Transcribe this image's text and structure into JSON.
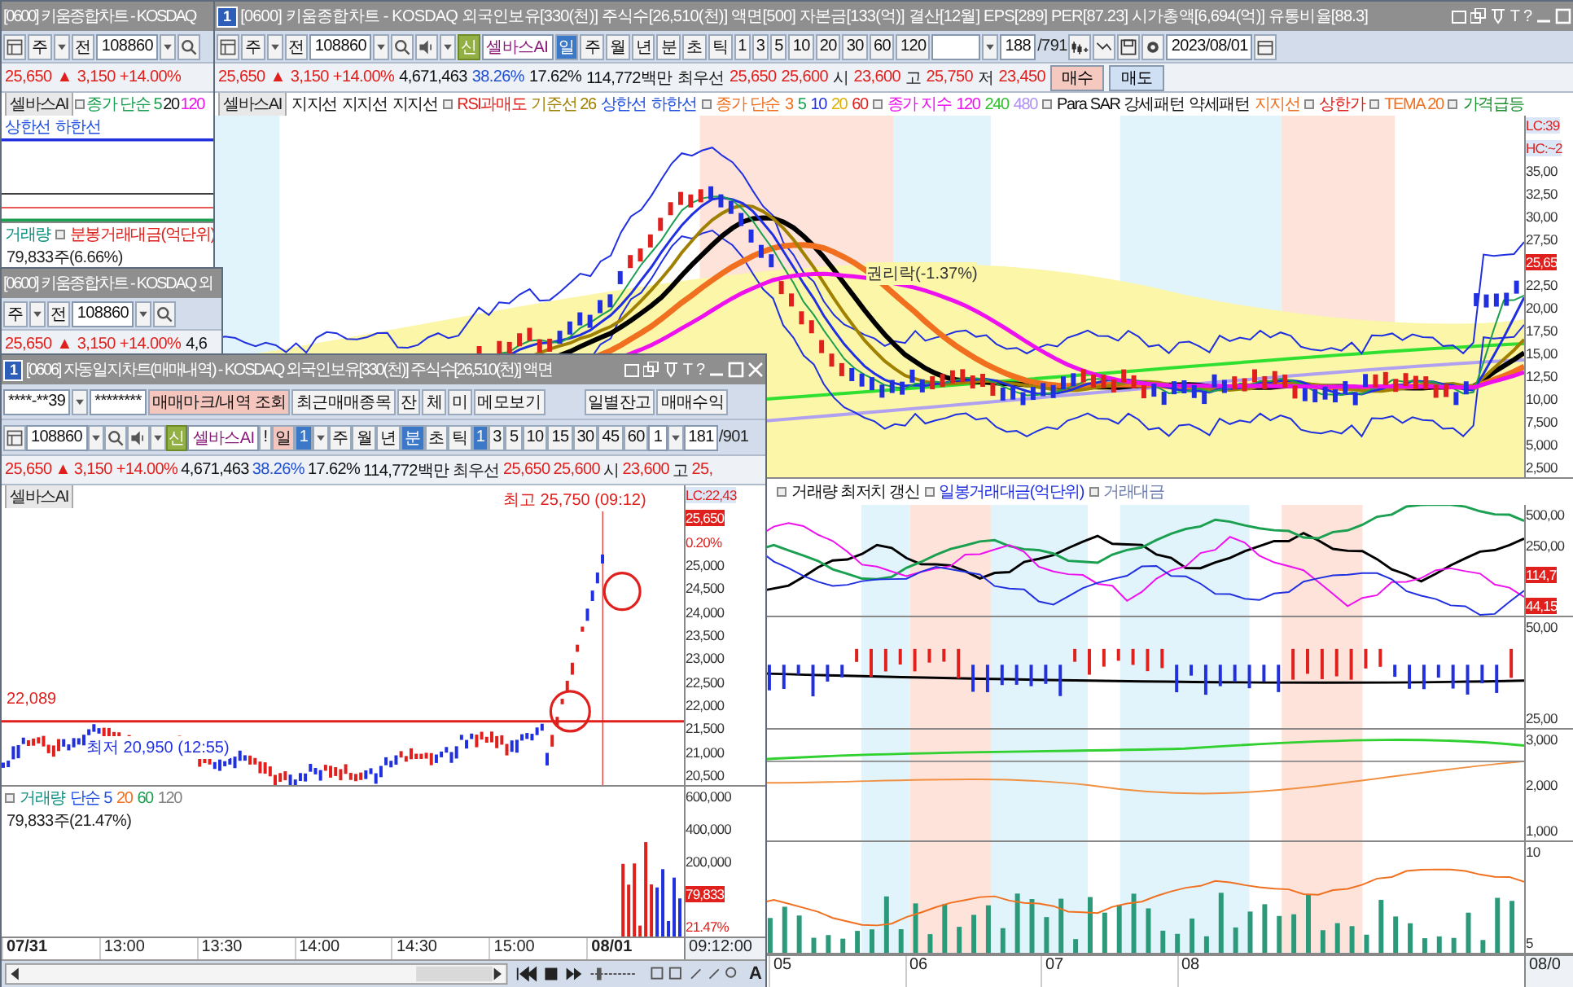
{
  "back_window_top": {
    "title": "[0600] 키움종합차트 - KOSDAQ",
    "toolbar": [
      {
        "kind": "layout"
      },
      {
        "kind": "button",
        "label": "주"
      },
      {
        "kind": "dropdown"
      },
      {
        "kind": "button",
        "label": "전"
      },
      {
        "kind": "field",
        "value": "108860"
      },
      {
        "kind": "dropdown"
      },
      {
        "kind": "search"
      }
    ],
    "info": [
      {
        "kind": "value",
        "text": "25,650",
        "color": "#e0201c"
      },
      {
        "kind": "value",
        "text": "▲",
        "color": "#e0201c"
      },
      {
        "kind": "value",
        "text": "3,150 +14.00%",
        "color": "#e0201c"
      }
    ],
    "legend": [
      {
        "kind": "label",
        "text": "셀바스AI"
      },
      {
        "kind": "marker"
      },
      {
        "kind": "text",
        "text": "종가 단순 5",
        "color": "#1aa050"
      },
      {
        "kind": "text",
        "text": "20",
        "color": "#111111"
      },
      {
        "kind": "text",
        "text": "120",
        "color": "#ee10ee"
      }
    ],
    "legend_2": [
      {
        "kind": "text",
        "text": "상한선",
        "color": "#2050e0"
      },
      {
        "kind": "text",
        "text": "하한선",
        "color": "#2050e0"
      }
    ],
    "volume_legend": [
      {
        "kind": "text",
        "text": "거래량",
        "color": "#109080"
      },
      {
        "kind": "marker"
      },
      {
        "kind": "text",
        "text": "분봉거래대금(억단위)",
        "color": "#e0201c"
      }
    ],
    "volume_reading": "79,833주(6.66%)"
  },
  "back_window_bottom": {
    "title": "[0600] 키움종합차트 - KOSDAQ 외",
    "toolbar": [
      {
        "kind": "button",
        "label": "주"
      },
      {
        "kind": "dropdown"
      },
      {
        "kind": "button",
        "label": "전"
      },
      {
        "kind": "field",
        "value": "108860"
      },
      {
        "kind": "dropdown"
      },
      {
        "kind": "search"
      }
    ],
    "info": [
      {
        "kind": "value",
        "text": "25,650",
        "color": "#e0201c"
      },
      {
        "kind": "value",
        "text": "▲",
        "color": "#e0201c"
      },
      {
        "kind": "value",
        "text": "3,150 +14.00%",
        "color": "#e0201c"
      },
      {
        "kind": "value",
        "text": "4,6",
        "color": "#111111"
      }
    ]
  },
  "main_window": {
    "badge": "1",
    "title": "[0600] 키움종합차트 - KOSDAQ 외국인보유[330(천)] 주식수[26,510(천)] 액면[500] 자본금[133(억)] 결산[12월] EPS[289] PER[87.23] 시가총액[6,694(억)] 유통비율[88.3]",
    "controls": [
      {
        "kind": "restore"
      },
      {
        "kind": "tile"
      },
      {
        "kind": "pin"
      },
      {
        "kind": "text",
        "label": "T"
      },
      {
        "kind": "text",
        "label": "?"
      },
      {
        "kind": "minimize"
      },
      {
        "kind": "maximize"
      }
    ],
    "toolbar": [
      {
        "kind": "layout"
      },
      {
        "kind": "button",
        "label": "주"
      },
      {
        "kind": "dropdown"
      },
      {
        "kind": "button",
        "label": "전"
      },
      {
        "kind": "field",
        "value": "108860"
      },
      {
        "kind": "dropdown"
      },
      {
        "kind": "search"
      },
      {
        "kind": "speaker"
      },
      {
        "kind": "dropdown"
      },
      {
        "kind": "tag",
        "label": "신"
      },
      {
        "kind": "name-field",
        "value": "셀바스AI"
      },
      {
        "kind": "toggle",
        "label": "일",
        "selected": true
      },
      {
        "kind": "toggle",
        "label": "주",
        "selected": false
      },
      {
        "kind": "toggle",
        "label": "월",
        "selected": false
      },
      {
        "kind": "toggle",
        "label": "년",
        "selected": false
      },
      {
        "kind": "toggle",
        "label": "분",
        "selected": false
      },
      {
        "kind": "toggle",
        "label": "초",
        "selected": false
      },
      {
        "kind": "toggle",
        "label": "틱",
        "selected": false
      },
      {
        "kind": "toggle",
        "label": "1",
        "selected": false
      },
      {
        "kind": "toggle",
        "label": "3",
        "selected": false
      },
      {
        "kind": "toggle",
        "label": "5",
        "selected": false
      },
      {
        "kind": "toggle",
        "label": "10",
        "selected": false
      },
      {
        "kind": "toggle",
        "label": "20",
        "selected": false
      },
      {
        "kind": "toggle",
        "label": "30",
        "selected": false
      },
      {
        "kind": "toggle",
        "label": "60",
        "selected": false
      },
      {
        "kind": "toggle",
        "label": "120",
        "selected": false
      },
      {
        "kind": "blank-field"
      },
      {
        "kind": "dropdown"
      },
      {
        "kind": "field",
        "value": "188"
      },
      {
        "kind": "text",
        "text": "/791"
      },
      {
        "kind": "tool-a"
      },
      {
        "kind": "tool-b"
      },
      {
        "kind": "save"
      },
      {
        "kind": "gear"
      },
      {
        "kind": "field",
        "value": "2023/08/01"
      },
      {
        "kind": "calendar"
      }
    ],
    "info": [
      {
        "kind": "value",
        "text": "25,650",
        "color": "#e0201c"
      },
      {
        "kind": "value",
        "text": "▲",
        "color": "#e0201c"
      },
      {
        "kind": "value",
        "text": "3,150 +14.00%",
        "color": "#e0201c"
      },
      {
        "kind": "value",
        "text": "4,671,463",
        "color": "#111111"
      },
      {
        "kind": "value",
        "text": "38.26%",
        "color": "#2050d0"
      },
      {
        "kind": "value",
        "text": "17.62%",
        "color": "#111111"
      },
      {
        "kind": "value",
        "text": "114,772백만",
        "color": "#111111"
      },
      {
        "kind": "label",
        "text": "최우선"
      },
      {
        "kind": "value",
        "text": "25,650",
        "color": "#e0201c"
      },
      {
        "kind": "value",
        "text": "25,600",
        "color": "#e0201c"
      },
      {
        "kind": "label",
        "text": "시"
      },
      {
        "kind": "value",
        "text": "23,600",
        "color": "#e0201c"
      },
      {
        "kind": "label",
        "text": "고"
      },
      {
        "kind": "value",
        "text": "25,750",
        "color": "#e0201c"
      },
      {
        "kind": "label",
        "text": "저"
      },
      {
        "kind": "value",
        "text": "23,450",
        "color": "#e0201c"
      },
      {
        "kind": "buy",
        "text": "매수"
      },
      {
        "kind": "sell",
        "text": "매도"
      }
    ],
    "legend": [
      {
        "kind": "label",
        "text": "셀바스AI"
      },
      {
        "kind": "text",
        "text": "지지선",
        "color": "#111111"
      },
      {
        "kind": "text",
        "text": "지지선",
        "color": "#111111"
      },
      {
        "kind": "text",
        "text": "지지선",
        "color": "#111111"
      },
      {
        "kind": "marker"
      },
      {
        "kind": "text",
        "text": "RSI과매도",
        "color": "#e0201c"
      },
      {
        "kind": "text",
        "text": "기준선 26",
        "color": "#a08000"
      },
      {
        "kind": "text",
        "text": "상한선",
        "color": "#2050e0"
      },
      {
        "kind": "text",
        "text": "하한선",
        "color": "#2050e0"
      },
      {
        "kind": "marker"
      },
      {
        "kind": "text",
        "text": "종가 단순",
        "color": "#f07020"
      },
      {
        "kind": "text",
        "text": "3",
        "color": "#f07020"
      },
      {
        "kind": "text",
        "text": "5",
        "color": "#1aa050"
      },
      {
        "kind": "text",
        "text": "10",
        "color": "#2030e0"
      },
      {
        "kind": "text",
        "text": "20",
        "color": "#e0b000"
      },
      {
        "kind": "text",
        "text": "60",
        "color": "#e0201c"
      },
      {
        "kind": "marker"
      },
      {
        "kind": "text",
        "text": "종가 지수",
        "color": "#ee10ee"
      },
      {
        "kind": "text",
        "text": "120",
        "color": "#ee10ee"
      },
      {
        "kind": "text",
        "text": "240",
        "color": "#30c030"
      },
      {
        "kind": "text",
        "text": "480",
        "color": "#b090f0"
      },
      {
        "kind": "marker"
      },
      {
        "kind": "text",
        "text": "Para SAR 강세패턴",
        "color": "#111111"
      },
      {
        "kind": "text",
        "text": "약세패턴",
        "color": "#111111"
      },
      {
        "kind": "text",
        "text": "지지선",
        "color": "#f07020"
      },
      {
        "kind": "marker"
      },
      {
        "kind": "text",
        "text": "상한가",
        "color": "#e0201c"
      },
      {
        "kind": "marker"
      },
      {
        "kind": "text",
        "text": "TEMA 20",
        "color": "#f07020"
      },
      {
        "kind": "marker"
      },
      {
        "kind": "text",
        "text": "가격급등",
        "color": "#1a9030"
      }
    ],
    "price_annotation": "권리락(-1.37%)",
    "price_axis": [
      {
        "kind": "info",
        "text": "LC:39"
      },
      {
        "kind": "info",
        "text": "HC:~2"
      },
      {
        "kind": "tick",
        "text": "35,00"
      },
      {
        "kind": "tick",
        "text": "32,50"
      },
      {
        "kind": "tick",
        "text": "30,00"
      },
      {
        "kind": "tick",
        "text": "27,50"
      },
      {
        "kind": "current",
        "text": "25,65"
      },
      {
        "kind": "tick",
        "text": "22,50"
      },
      {
        "kind": "tick",
        "text": "20,00"
      },
      {
        "kind": "tick",
        "text": "17,50"
      },
      {
        "kind": "tick",
        "text": "15,00"
      },
      {
        "kind": "tick",
        "text": "12,50"
      },
      {
        "kind": "tick",
        "text": "10,00"
      },
      {
        "kind": "tick",
        "text": "7,500"
      },
      {
        "kind": "tick",
        "text": "5,000"
      },
      {
        "kind": "tick",
        "text": "2,500"
      }
    ],
    "lower_legend": [
      {
        "kind": "marker"
      },
      {
        "kind": "text",
        "text": "거래량 최저치 갱신",
        "color": "#111111"
      },
      {
        "kind": "marker"
      },
      {
        "kind": "text",
        "text": "일봉거래대금(억단위)",
        "color": "#2030e0"
      },
      {
        "kind": "marker"
      },
      {
        "kind": "text",
        "text": "거래대금",
        "color": "#7080b0"
      }
    ],
    "panels": [
      {
        "kind": "lines",
        "axis": [
          {
            "kind": "tick",
            "text": "500,00"
          },
          {
            "kind": "tick",
            "text": "250,00"
          },
          {
            "kind": "current",
            "text": "114,7"
          },
          {
            "kind": "current",
            "text": "44,15"
          }
        ]
      },
      {
        "kind": "bars",
        "axis": [
          {
            "kind": "tick",
            "text": "50,00"
          },
          {
            "kind": "tick",
            "text": "25,00"
          }
        ]
      },
      {
        "kind": "oscillator",
        "axis": [
          {
            "kind": "tick",
            "text": "3,000"
          },
          {
            "kind": "tick",
            "text": "2,000"
          },
          {
            "kind": "tick",
            "text": "1,000"
          }
        ]
      },
      {
        "kind": "volume",
        "axis": [
          {
            "kind": "tick",
            "text": "10"
          },
          {
            "kind": "tick",
            "text": "5"
          }
        ]
      }
    ],
    "x_axis": [
      "05",
      "06",
      "07",
      "08"
    ],
    "x_axis_end": "08/0"
  },
  "front_window": {
    "badge": "1",
    "title": "[0606] 자동일지차트(매매내역) - KOSDAQ 외국인보유[330(천)] 주식수[26,510(천)] 액면",
    "controls": [
      {
        "kind": "restore"
      },
      {
        "kind": "tile"
      },
      {
        "kind": "pin"
      },
      {
        "kind": "text",
        "label": "T"
      },
      {
        "kind": "text",
        "label": "?"
      },
      {
        "kind": "minimize"
      },
      {
        "kind": "maximize"
      },
      {
        "kind": "close"
      }
    ],
    "toolbar": [
      {
        "kind": "field",
        "value": "****-**39"
      },
      {
        "kind": "dropdown"
      },
      {
        "kind": "field",
        "value": "********"
      },
      {
        "kind": "accent-button",
        "label": "매매마크/내역 조회"
      },
      {
        "kind": "button",
        "label": "최근매매종목"
      },
      {
        "kind": "button",
        "label": "잔"
      },
      {
        "kind": "button",
        "label": "체"
      },
      {
        "kind": "button",
        "label": "미"
      },
      {
        "kind": "button",
        "label": "메모보기"
      },
      {
        "kind": "gap"
      },
      {
        "kind": "button",
        "label": "일별잔고"
      },
      {
        "kind": "button",
        "label": "매매수익"
      }
    ],
    "toolbar_2": [
      {
        "kind": "layout"
      },
      {
        "kind": "field",
        "value": "108860"
      },
      {
        "kind": "dropdown"
      },
      {
        "kind": "search"
      },
      {
        "kind": "speaker"
      },
      {
        "kind": "dropdown"
      },
      {
        "kind": "tag",
        "label": "신"
      },
      {
        "kind": "name-field",
        "value": "셀바스AI"
      },
      {
        "kind": "button",
        "label": "!"
      },
      {
        "kind": "accent-button",
        "label": "일"
      },
      {
        "kind": "toggle",
        "label": "1",
        "selected": true
      },
      {
        "kind": "dropdown"
      },
      {
        "kind": "toggle",
        "label": "주",
        "selected": false
      },
      {
        "kind": "toggle",
        "label": "월",
        "selected": false
      },
      {
        "kind": "toggle",
        "label": "년",
        "selected": false
      },
      {
        "kind": "toggle",
        "label": "분",
        "selected": true
      },
      {
        "kind": "toggle",
        "label": "초",
        "selected": false
      },
      {
        "kind": "toggle",
        "label": "틱",
        "selected": false
      },
      {
        "kind": "toggle",
        "label": "1",
        "selected": true
      },
      {
        "kind": "toggle",
        "label": "3",
        "selected": false
      },
      {
        "kind": "toggle",
        "label": "5",
        "selected": false
      },
      {
        "kind": "toggle",
        "label": "10",
        "selected": false
      },
      {
        "kind": "toggle",
        "label": "15",
        "selected": false
      },
      {
        "kind": "toggle",
        "label": "30",
        "selected": false
      },
      {
        "kind": "toggle",
        "label": "45",
        "selected": false
      },
      {
        "kind": "toggle",
        "label": "60",
        "selected": false
      },
      {
        "kind": "field",
        "value": "1"
      },
      {
        "kind": "dropdown"
      },
      {
        "kind": "field",
        "value": "181"
      },
      {
        "kind": "text",
        "text": "/901"
      }
    ],
    "info": [
      {
        "kind": "value",
        "text": "25,650",
        "color": "#e0201c"
      },
      {
        "kind": "value",
        "text": "▲",
        "color": "#e0201c"
      },
      {
        "kind": "value",
        "text": "3,150 +14.00%",
        "color": "#e0201c"
      },
      {
        "kind": "value",
        "text": "4,671,463",
        "color": "#111111"
      },
      {
        "kind": "value",
        "text": "38.26%",
        "color": "#2050d0"
      },
      {
        "kind": "value",
        "text": "17.62%",
        "color": "#111111"
      },
      {
        "kind": "value",
        "text": "114,772백만",
        "color": "#111111"
      },
      {
        "kind": "label",
        "text": "최우선"
      },
      {
        "kind": "value",
        "text": "25,650",
        "color": "#e0201c"
      },
      {
        "kind": "value",
        "text": "25,600",
        "color": "#e0201c"
      },
      {
        "kind": "label",
        "text": "시"
      },
      {
        "kind": "value",
        "text": "23,600",
        "color": "#e0201c"
      },
      {
        "kind": "label",
        "text": "고"
      },
      {
        "kind": "value",
        "text": "25,",
        "color": "#e0201c"
      }
    ],
    "legend": [
      {
        "kind": "label",
        "text": "셀바스AI"
      }
    ],
    "high_note": "최고 25,750 (09:12)",
    "low_note": "최저 20,950 (12:55)",
    "line_note": "22,089",
    "price_axis": [
      {
        "kind": "info",
        "text": "LC:22,43"
      },
      {
        "kind": "current",
        "text": "25,650"
      },
      {
        "kind": "note",
        "text": "0.20%"
      },
      {
        "kind": "tick",
        "text": "25,000"
      },
      {
        "kind": "tick",
        "text": "24,500"
      },
      {
        "kind": "tick",
        "text": "24,000"
      },
      {
        "kind": "tick",
        "text": "23,500"
      },
      {
        "kind": "tick",
        "text": "23,000"
      },
      {
        "kind": "tick",
        "text": "22,500"
      },
      {
        "kind": "tick",
        "text": "22,000"
      },
      {
        "kind": "tick",
        "text": "21,500"
      },
      {
        "kind": "tick",
        "text": "21,000"
      },
      {
        "kind": "tick",
        "text": "20,500"
      }
    ],
    "volume_legend": [
      {
        "kind": "marker"
      },
      {
        "kind": "text",
        "text": "거래량",
        "color": "#109080"
      },
      {
        "kind": "text",
        "text": "단순 5",
        "color": "#2050e0"
      },
      {
        "kind": "text",
        "text": "20",
        "color": "#f07020"
      },
      {
        "kind": "text",
        "text": "60",
        "color": "#1aa050"
      },
      {
        "kind": "text",
        "text": "120",
        "color": "#808080"
      }
    ],
    "volume_reading": "79,833주(21.47%)",
    "volume_axis": [
      {
        "kind": "tick",
        "text": "600,000"
      },
      {
        "kind": "tick",
        "text": "400,000"
      },
      {
        "kind": "tick",
        "text": "200,000"
      },
      {
        "kind": "current",
        "text": "79,833"
      },
      {
        "kind": "note",
        "text": "21.47%"
      }
    ],
    "x_axis": [
      {
        "text": "07/31",
        "bold": true
      },
      {
        "text": "13:00",
        "bold": false
      },
      {
        "text": "13:30",
        "bold": false
      },
      {
        "text": "14:00",
        "bold": false
      },
      {
        "text": "14:30",
        "bold": false
      },
      {
        "text": "15:00",
        "bold": false
      },
      {
        "text": "08/01",
        "bold": true
      }
    ],
    "x_axis_end": "09:12:00",
    "zoom_label": "A"
  }
}
